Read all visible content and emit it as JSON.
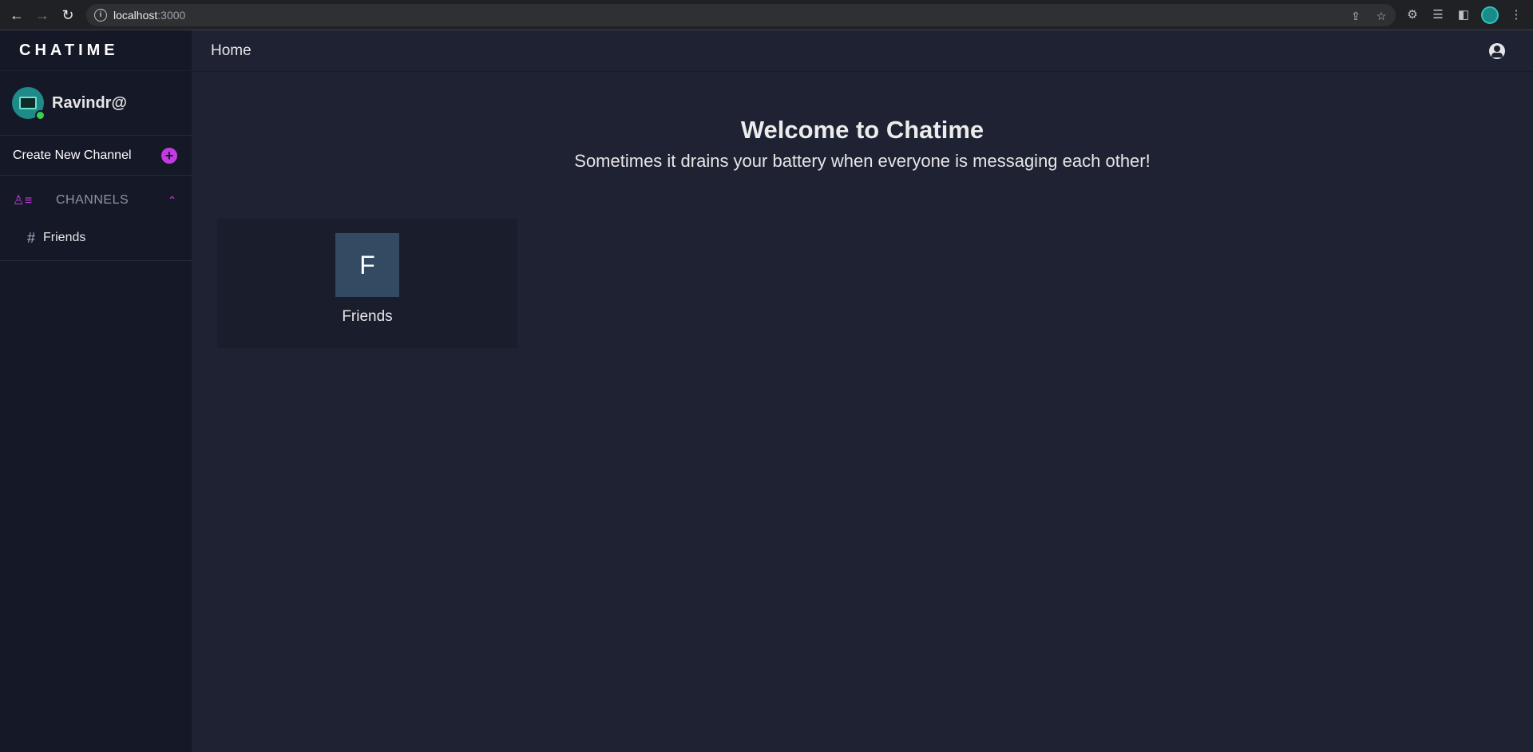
{
  "browser": {
    "url_host": "localhost",
    "url_port": ":3000"
  },
  "sidebar": {
    "brand": "CHATIME",
    "username": "Ravindr@",
    "create_channel_label": "Create New Channel",
    "channels_header": "CHANNELS",
    "channels": [
      {
        "label": "Friends"
      }
    ]
  },
  "header": {
    "title": "Home"
  },
  "welcome": {
    "title": "Welcome to Chatime",
    "subtitle": "Sometimes it drains your battery when everyone is messaging each other!"
  },
  "cards": [
    {
      "initial": "F",
      "name": "Friends"
    }
  ],
  "colors": {
    "accent": "#c23be0",
    "online": "#3ccf4e",
    "tile": "#324b63"
  }
}
